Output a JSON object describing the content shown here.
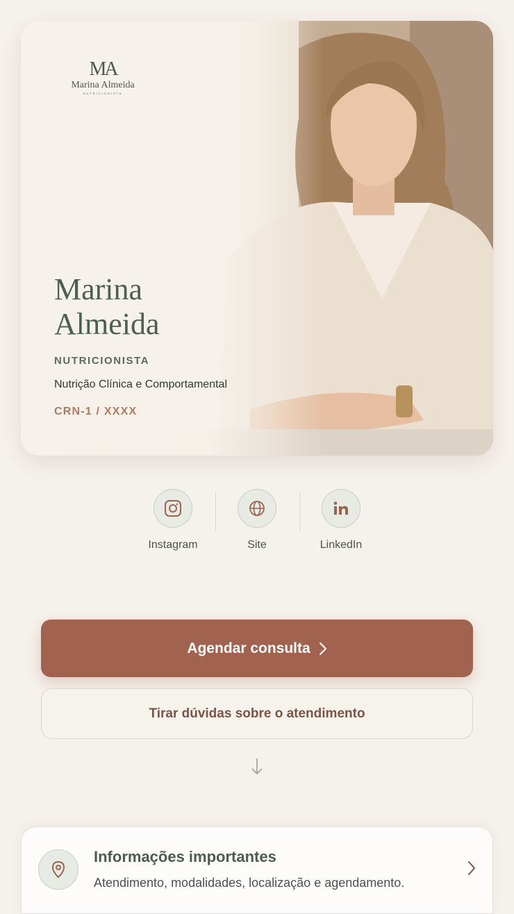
{
  "logo": {
    "mark": "MA",
    "name": "Marina Almeida",
    "subtitle": "NUTRICIONISTA"
  },
  "profile": {
    "first_name": "Marina",
    "last_name": "Almeida",
    "profession": "NUTRICIONISTA",
    "specialty": "Nutrição Clínica e Comportamental",
    "crn": "CRN-1 / XXXX"
  },
  "socials": [
    {
      "label": "Instagram",
      "icon": "instagram-icon"
    },
    {
      "label": "Site",
      "icon": "globe-icon"
    },
    {
      "label": "LinkedIn",
      "icon": "linkedin-icon"
    }
  ],
  "actions": {
    "primary_label": "Agendar consulta",
    "secondary_label": "Tirar dúvidas sobre o atendimento"
  },
  "info_card": {
    "title": "Informações importantes",
    "subtitle": "Atendimento, modalidades, localização e agendamento.",
    "icon": "map-pin-icon"
  },
  "colors": {
    "background": "#f5f1eb",
    "accent": "#a26250",
    "heading_green": "#4d5f50",
    "crn_terracotta": "#b07a63"
  }
}
